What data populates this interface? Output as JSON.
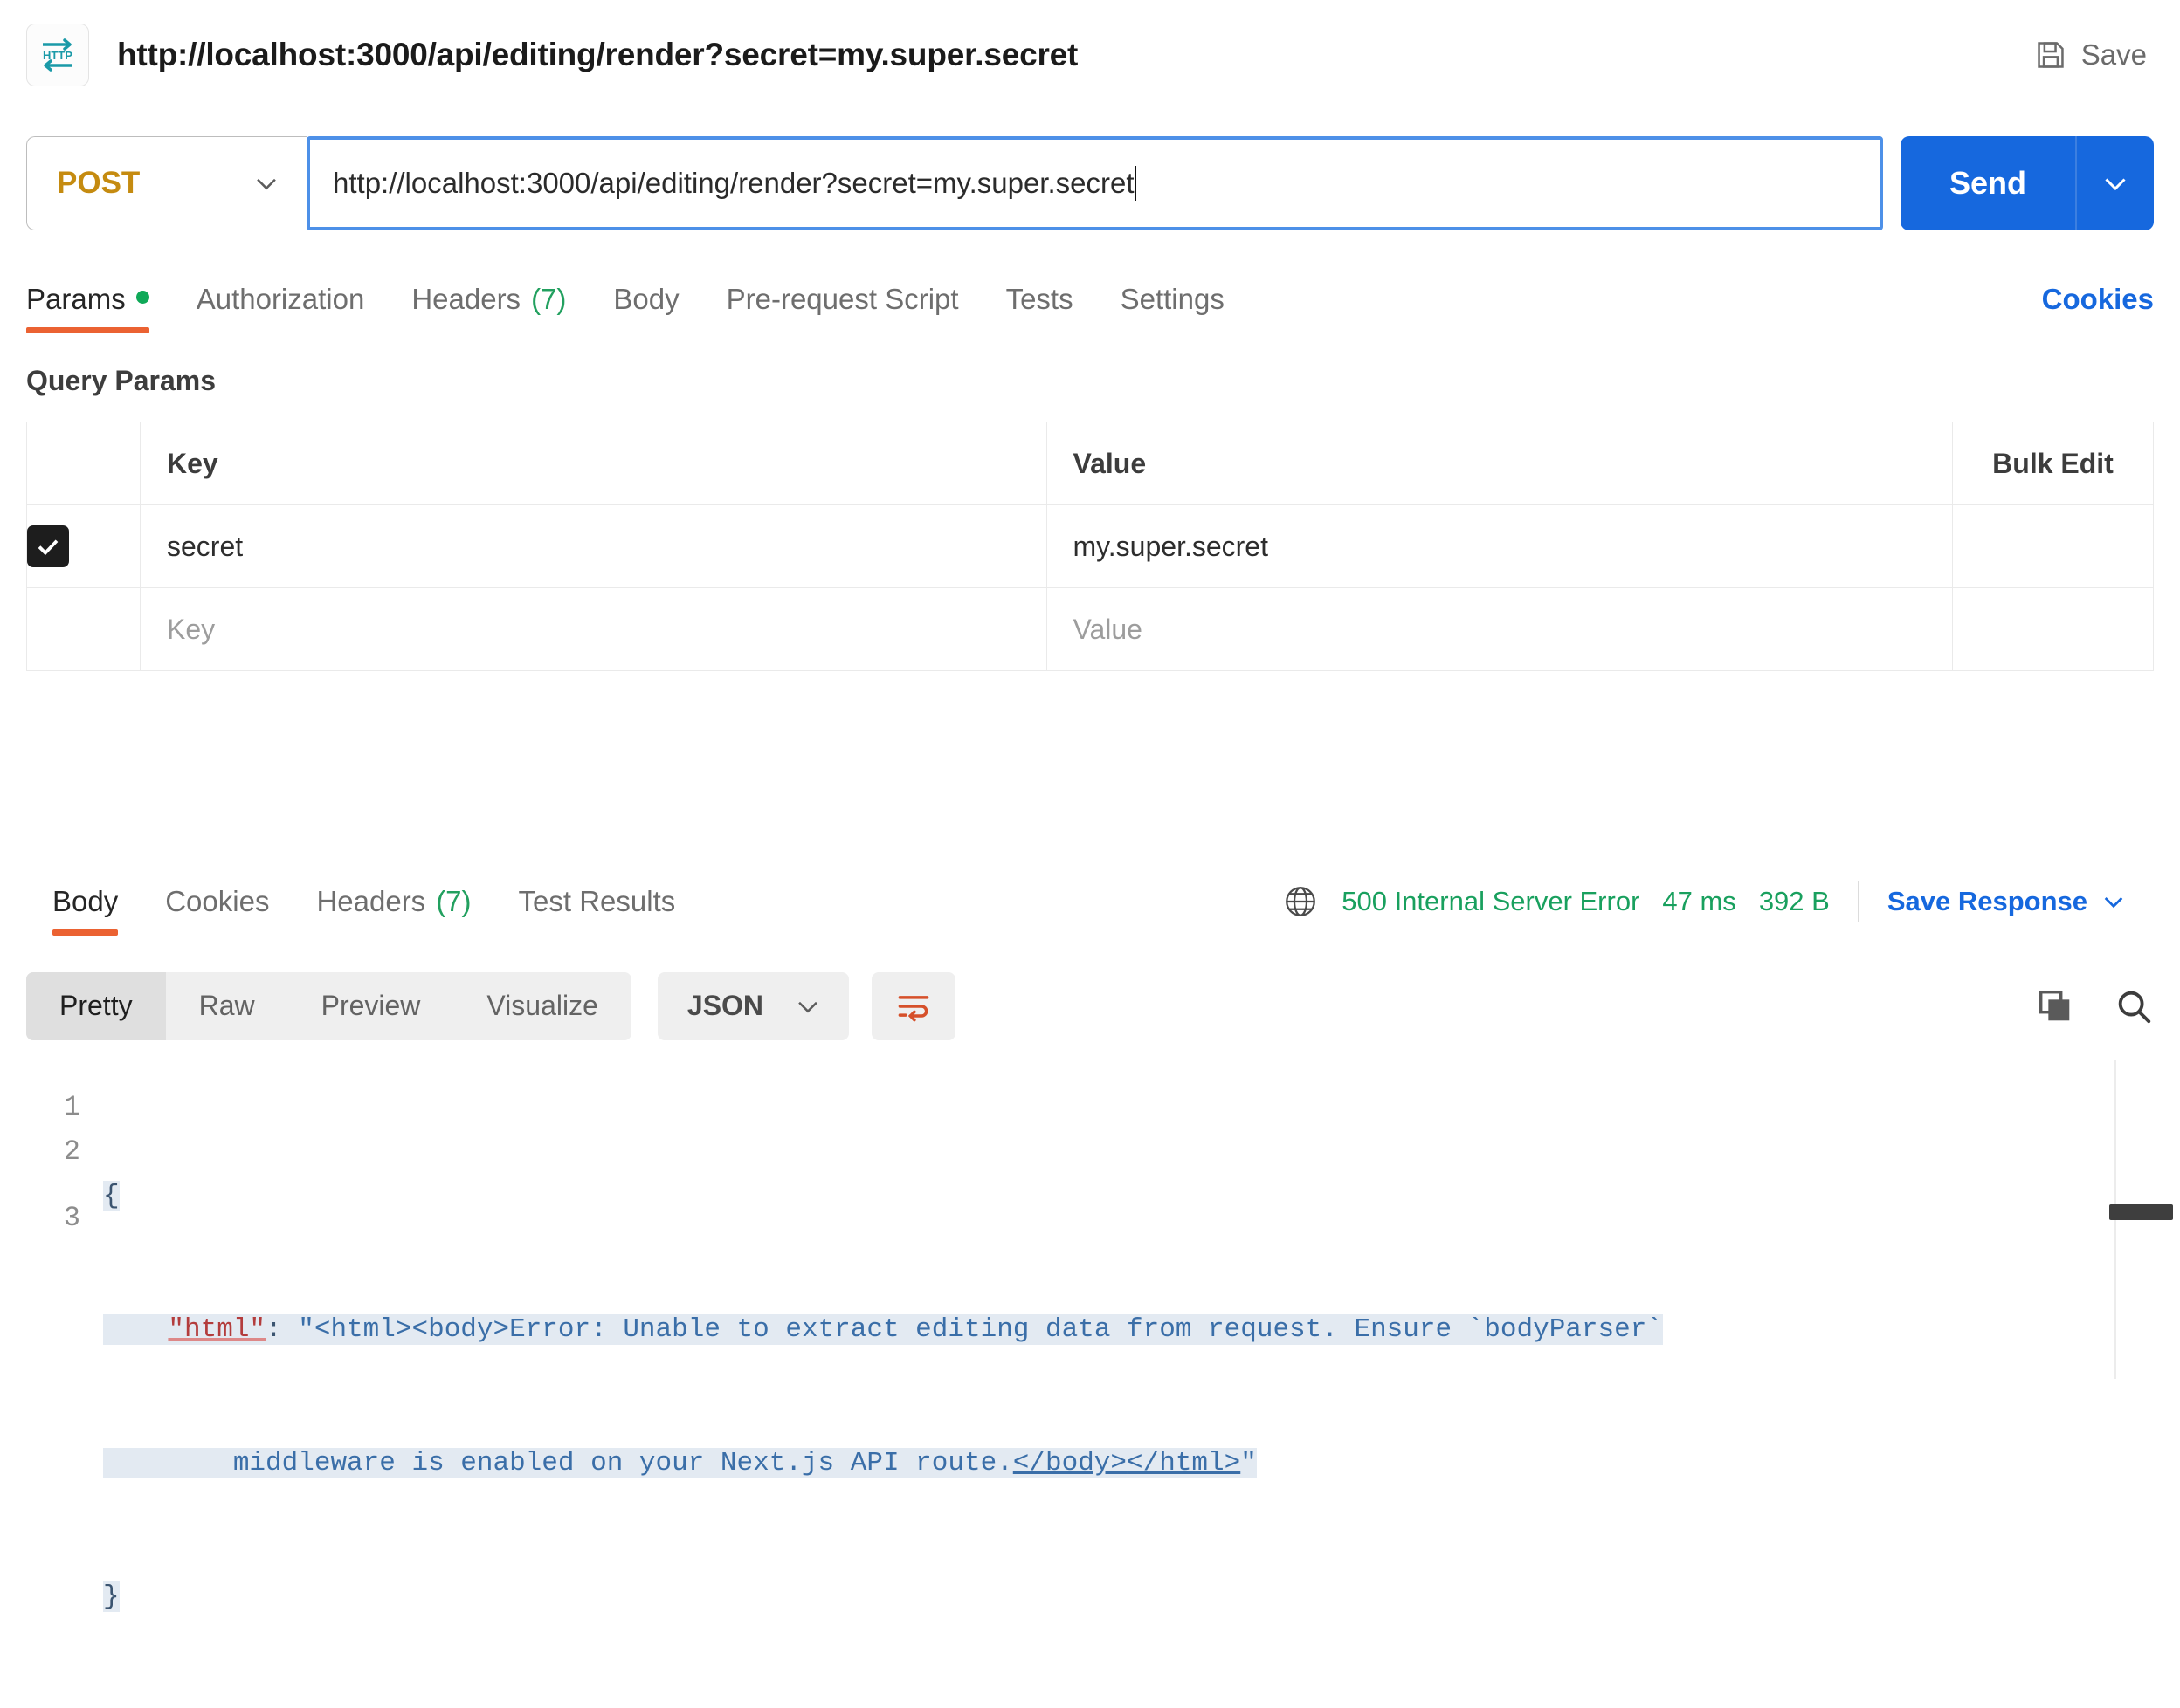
{
  "header": {
    "protocol_badge": "HTTP",
    "title": "http://localhost:3000/api/editing/render?secret=my.super.secret",
    "save_label": "Save",
    "save_icon": "floppy-disk-icon"
  },
  "url_bar": {
    "method": "POST",
    "method_color": "#c58b10",
    "url_value": "http://localhost:3000/api/editing/render?secret=my.super.secret",
    "send_label": "Send",
    "send_color": "#1668de",
    "chevron_icon": "chevron-down-icon"
  },
  "request_tabs": {
    "items": [
      {
        "label": "Params",
        "badge_dot": true,
        "active": true
      },
      {
        "label": "Authorization",
        "active": false
      },
      {
        "label": "Headers",
        "count": "(7)",
        "active": false
      },
      {
        "label": "Body",
        "active": false
      },
      {
        "label": "Pre-request Script",
        "active": false
      },
      {
        "label": "Tests",
        "active": false
      },
      {
        "label": "Settings",
        "active": false
      }
    ],
    "cookies_label": "Cookies",
    "active_underline_color": "#eb6232",
    "dot_color": "#0fa958"
  },
  "query_params": {
    "section_title": "Query Params",
    "columns": [
      "Key",
      "Value",
      "Bulk Edit"
    ],
    "rows": [
      {
        "checked": true,
        "key": "secret",
        "value": "my.super.secret"
      }
    ],
    "empty_row": {
      "key_placeholder": "Key",
      "value_placeholder": "Value"
    }
  },
  "response": {
    "tabs": [
      {
        "label": "Body",
        "active": true
      },
      {
        "label": "Cookies",
        "active": false
      },
      {
        "label": "Headers",
        "count": "(7)",
        "active": false
      },
      {
        "label": "Test Results",
        "active": false
      }
    ],
    "globe_icon": "globe-icon",
    "status_text": "500 Internal Server Error",
    "time_text": "47 ms",
    "size_text": "392 B",
    "status_color": "#19a05e",
    "save_response_label": "Save Response"
  },
  "response_toolbar": {
    "view_modes": [
      {
        "label": "Pretty",
        "active": true
      },
      {
        "label": "Raw",
        "active": false
      },
      {
        "label": "Preview",
        "active": false
      },
      {
        "label": "Visualize",
        "active": false
      }
    ],
    "format_selected": "JSON",
    "wrap_icon": "word-wrap-icon",
    "wrap_icon_color": "#d6502a",
    "copy_icon": "copy-icon",
    "search_icon": "search-icon"
  },
  "code_body": {
    "line_numbers": [
      "1",
      "2",
      "3"
    ],
    "line1": "{",
    "line2_key": "\"html\"",
    "line2_colon": ": ",
    "line2_value_part1": "\"<html><body>Error: Unable to extract editing data from request. Ensure `bodyParser`",
    "line2_value_part2_pre": "middleware is enabled on your Next.js API route.",
    "line2_value_body_tag": "</body>",
    "line2_value_html_tag": "</html>",
    "line2_value_quote": "\"",
    "line3": "}"
  }
}
